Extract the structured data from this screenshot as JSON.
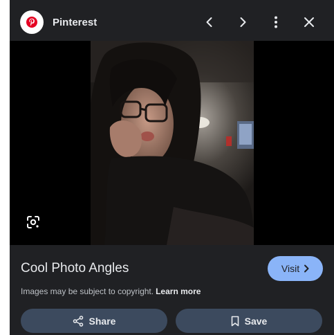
{
  "header": {
    "source_name": "Pinterest",
    "source_logo_icon": "pinterest-logo",
    "prev_icon": "chevron-left-icon",
    "next_icon": "chevron-right-icon",
    "more_icon": "more-vert-icon",
    "close_icon": "close-icon"
  },
  "image": {
    "lens_icon": "google-lens-icon"
  },
  "details": {
    "title": "Cool Photo Angles",
    "visit_label": "Visit",
    "copyright_text": "Images may be subject to copyright.",
    "learn_more_label": "Learn more"
  },
  "actions": {
    "share_label": "Share",
    "save_label": "Save"
  },
  "colors": {
    "panel_bg": "#202124",
    "visit_bg": "#8ab4f8",
    "action_bg": "#3c4a5e",
    "pinterest_red": "#e60023"
  }
}
